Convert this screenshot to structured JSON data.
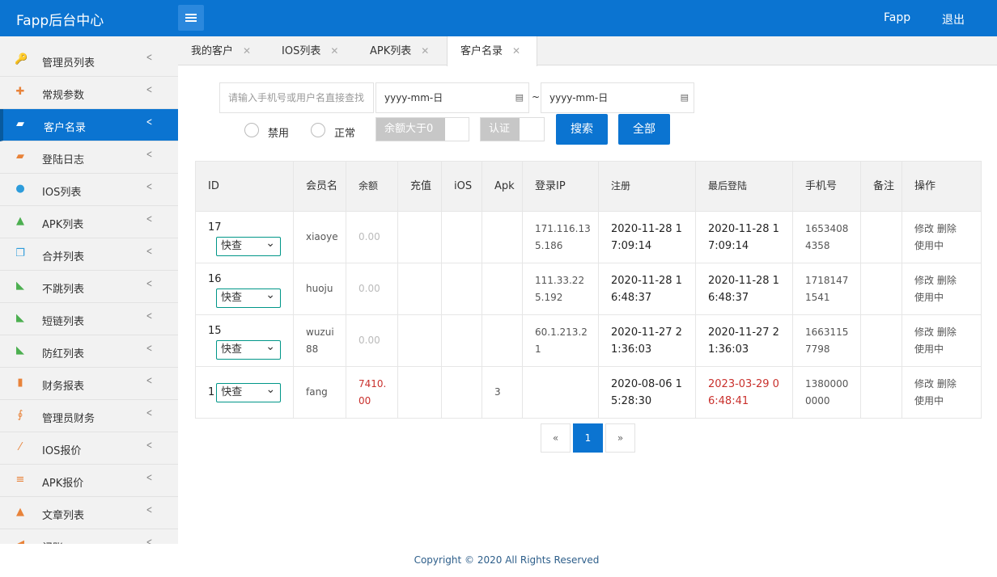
{
  "header": {
    "brand": "Fapp后台中心",
    "user": "Fapp",
    "logout": "退出"
  },
  "sidebar": {
    "items": [
      {
        "label": "管理员列表",
        "icon": "key-icon",
        "glyph": "🔑",
        "color": "#e8833a"
      },
      {
        "label": "常规参数",
        "icon": "plus-icon",
        "glyph": "✚",
        "color": "#e8833a"
      },
      {
        "label": "客户名录",
        "icon": "briefcase-icon",
        "glyph": "▰",
        "color": "#e8833a",
        "active": true
      },
      {
        "label": "登陆日志",
        "icon": "briefcase-icon",
        "glyph": "▰",
        "color": "#e8833a"
      },
      {
        "label": "IOS列表",
        "icon": "apple-icon",
        "glyph": "●",
        "color": "#2d9cdb"
      },
      {
        "label": "APK列表",
        "icon": "android-icon",
        "glyph": "▲",
        "color": "#4caf50"
      },
      {
        "label": "合并列表",
        "icon": "copy-icon",
        "glyph": "❐",
        "color": "#2d9cdb"
      },
      {
        "label": "不跳列表",
        "icon": "rss-icon",
        "glyph": "◣",
        "color": "#4caf50"
      },
      {
        "label": "短链列表",
        "icon": "rss-icon",
        "glyph": "◣",
        "color": "#4caf50"
      },
      {
        "label": "防红列表",
        "icon": "rss-icon",
        "glyph": "◣",
        "color": "#4caf50"
      },
      {
        "label": "财务报表",
        "icon": "files-icon",
        "glyph": "▮",
        "color": "#e8833a"
      },
      {
        "label": "管理员财务",
        "icon": "stethoscope-icon",
        "glyph": "∮",
        "color": "#e8833a"
      },
      {
        "label": "IOS报价",
        "icon": "magic-wand-icon",
        "glyph": "⁄",
        "color": "#e8833a"
      },
      {
        "label": "APK报价",
        "icon": "list-icon",
        "glyph": "≡",
        "color": "#e8833a"
      },
      {
        "label": "文章列表",
        "icon": "flask-icon",
        "glyph": "▲",
        "color": "#e8833a"
      },
      {
        "label": "记账",
        "icon": "bullhorn-icon",
        "glyph": "◀",
        "color": "#e8833a"
      }
    ]
  },
  "tabs": [
    {
      "label": "我的客户"
    },
    {
      "label": "IOS列表"
    },
    {
      "label": "APK列表"
    },
    {
      "label": "客户名录",
      "active": true
    }
  ],
  "filters": {
    "search_placeholder": "请输入手机号或用户名直接查找",
    "date_from_placeholder": "yyyy-mm-日",
    "date_to_placeholder": "yyyy-mm-日",
    "date_sep": "~",
    "radio_banned": "禁用",
    "radio_normal": "正常",
    "switch_balance": "余额大于0",
    "switch_verified": "认证",
    "search_button": "搜索",
    "all_button": "全部"
  },
  "table": {
    "headers": [
      "ID",
      "会员名",
      "余额",
      "充值",
      "iOS",
      "Apk",
      "登录IP",
      "注册",
      "最后登陆",
      "手机号",
      "备注",
      "操作"
    ],
    "rows": [
      {
        "id": "17",
        "quick": "快查",
        "name": "xiaoye",
        "balance": "0.00",
        "recharge": "",
        "ios": "",
        "apk": "",
        "ip": "171.116.135.186",
        "register": "2020-11-28 17:09:14",
        "last_login": "2020-11-28 17:09:14",
        "phone": "16534084358",
        "note": "",
        "actions": "修改 删除",
        "status": "使用中"
      },
      {
        "id": "16",
        "quick": "快查",
        "name": "huoju",
        "balance": "0.00",
        "recharge": "",
        "ios": "",
        "apk": "",
        "ip": "111.33.225.192",
        "register": "2020-11-28 16:48:37",
        "last_login": "2020-11-28 16:48:37",
        "phone": "17181471541",
        "note": "",
        "actions": "修改 删除",
        "status": "使用中"
      },
      {
        "id": "15",
        "quick": "快查",
        "name": "wuzui88",
        "balance": "0.00",
        "recharge": "",
        "ios": "",
        "apk": "",
        "ip": "60.1.213.21",
        "register": "2020-11-27 21:36:03",
        "last_login": "2020-11-27 21:36:03",
        "phone": "16631157798",
        "note": "",
        "actions": "修改 删除",
        "status": "使用中"
      },
      {
        "id": "1",
        "quick": "快查",
        "name": "fang",
        "balance": "7410.00",
        "recharge": "",
        "ios": "",
        "apk": "3",
        "ip": "",
        "register": "2020-08-06 15:28:30",
        "last_login": "2023-03-29 06:48:41",
        "phone": "13800000000",
        "note": "",
        "actions": "修改 删除",
        "status": "使用中"
      }
    ]
  },
  "pagination": {
    "prev": "«",
    "current": "1",
    "next": "»"
  },
  "footer": {
    "copyright": "Copyright © 2020 All Rights Reserved"
  },
  "colors": {
    "primary": "#0b74d1",
    "highlight_red": "#c9302c"
  }
}
